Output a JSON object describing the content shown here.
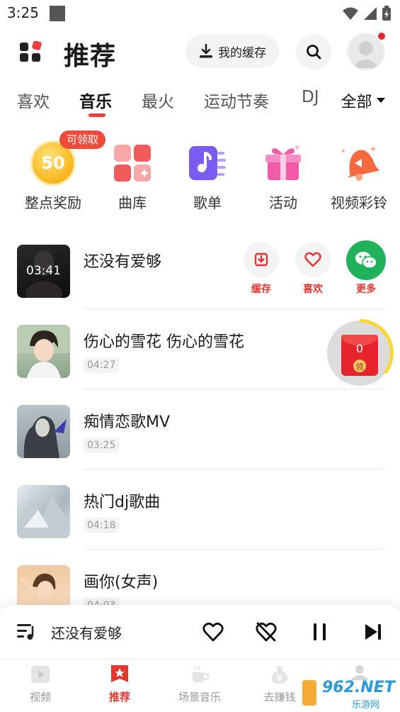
{
  "status_bar": {
    "time": "3:25"
  },
  "header": {
    "title": "推荐",
    "cache_label": "我的缓存"
  },
  "tabs": [
    {
      "label": "喜欢"
    },
    {
      "label": "音乐"
    },
    {
      "label": "最火"
    },
    {
      "label": "运动节奏"
    },
    {
      "label": "DJ"
    }
  ],
  "tabs_all_label": "全部",
  "quick_entries": [
    {
      "label": "整点奖励",
      "coin_value": "50",
      "badge": "可领取"
    },
    {
      "label": "曲库"
    },
    {
      "label": "歌单"
    },
    {
      "label": "活动"
    },
    {
      "label": "视频彩铃"
    }
  ],
  "songs": [
    {
      "title": "还没有爱够",
      "cover_text": "03:41"
    },
    {
      "title": "伤心的雪花 伤心的雪花",
      "duration": "04:27"
    },
    {
      "title": "痴情恋歌MV",
      "duration": "03:25"
    },
    {
      "title": "热门dj歌曲",
      "duration": "04:18"
    },
    {
      "title": "画你(女声)",
      "duration": "04:03"
    }
  ],
  "song_actions": {
    "cache": "缓存",
    "like": "喜欢",
    "more": "更多"
  },
  "red_packet": {
    "count": "0",
    "claim": "领"
  },
  "player": {
    "title": "还没有爱够"
  },
  "bottom_nav": [
    {
      "label": "视频"
    },
    {
      "label": "推荐"
    },
    {
      "label": "场景音乐"
    },
    {
      "label": "去赚钱"
    },
    {
      "label": ""
    }
  ],
  "watermark": {
    "brand": "962.NET",
    "sub": "乐游网"
  },
  "colors": {
    "accent": "#e8342f",
    "wechat_green": "#1fb25a",
    "coin_gold": "#f7b51b"
  }
}
